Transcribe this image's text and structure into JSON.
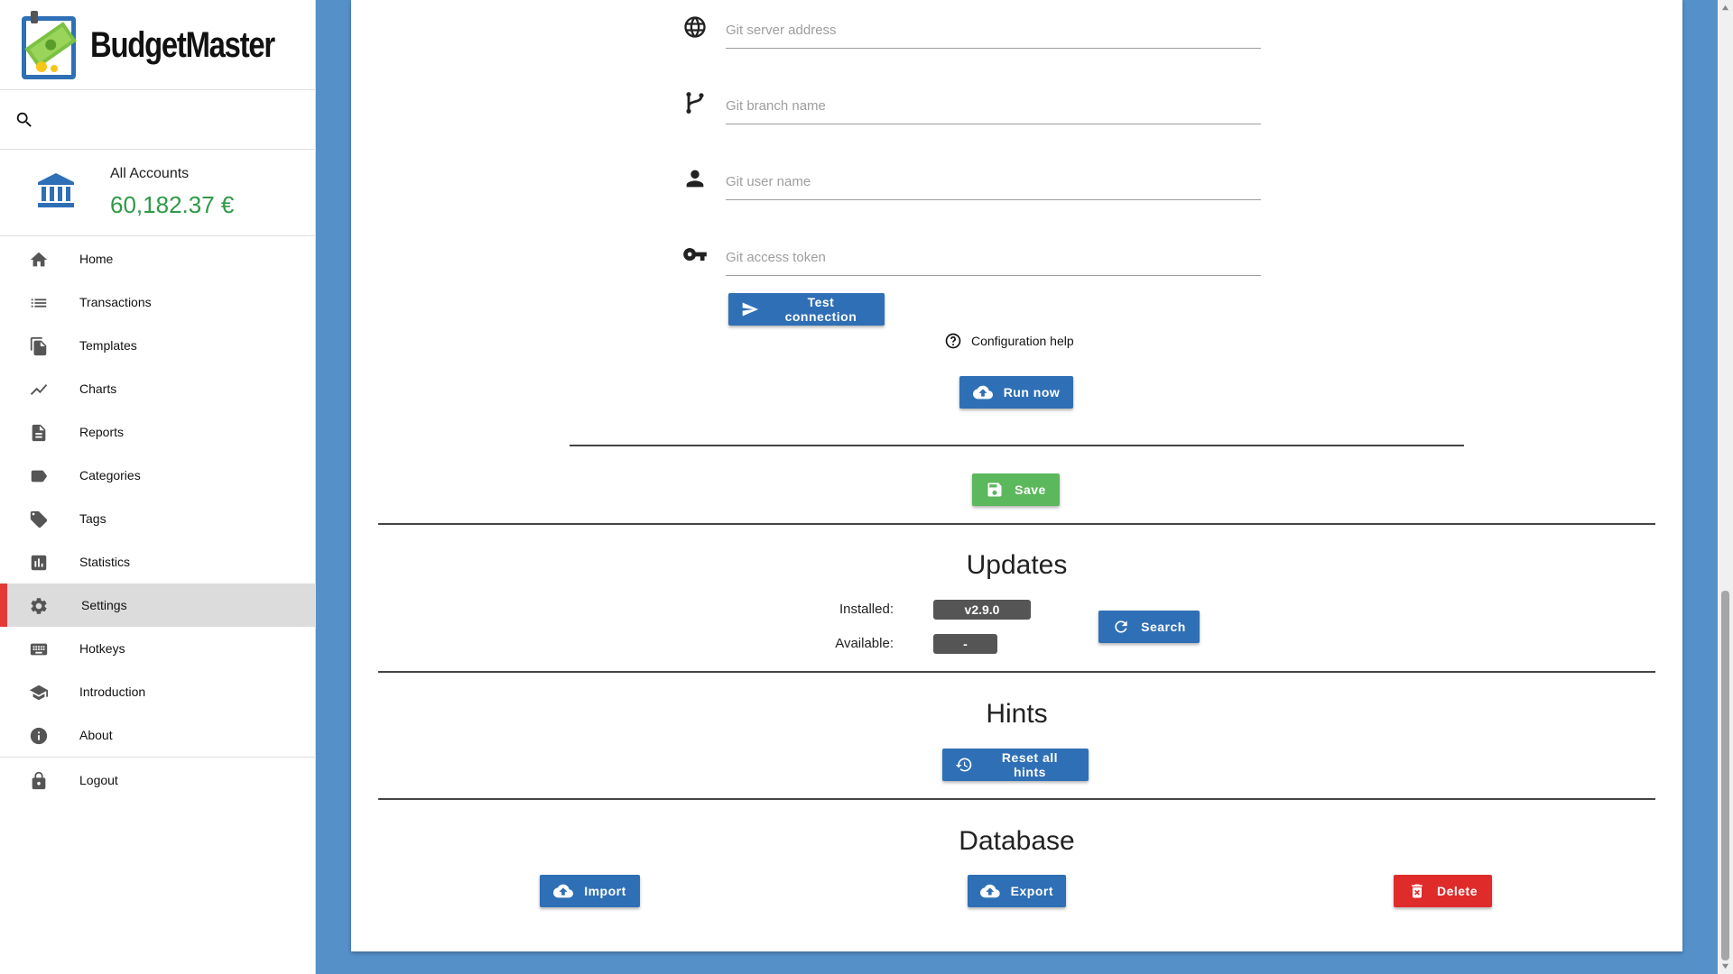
{
  "app": {
    "name": "BudgetMaster",
    "search_placeholder": ""
  },
  "account": {
    "label": "All Accounts",
    "balance": "60,182.37 €",
    "balance_color": "#2e9a47"
  },
  "nav": {
    "items": [
      {
        "label": "Home",
        "icon": "home-icon"
      },
      {
        "label": "Transactions",
        "icon": "list-icon"
      },
      {
        "label": "Templates",
        "icon": "copy-icon"
      },
      {
        "label": "Charts",
        "icon": "line-chart-icon"
      },
      {
        "label": "Reports",
        "icon": "document-icon"
      },
      {
        "label": "Categories",
        "icon": "label-icon"
      },
      {
        "label": "Tags",
        "icon": "tag-icon"
      },
      {
        "label": "Statistics",
        "icon": "bar-chart-icon"
      },
      {
        "label": "Settings",
        "icon": "gear-icon",
        "active": true
      },
      {
        "label": "Hotkeys",
        "icon": "keyboard-icon"
      },
      {
        "label": "Introduction",
        "icon": "graduation-cap-icon"
      },
      {
        "label": "About",
        "icon": "info-icon"
      }
    ],
    "logout": {
      "label": "Logout",
      "icon": "lock-icon"
    },
    "active_marker_color": "#e53935"
  },
  "git": {
    "server_placeholder": "Git server address",
    "branch_placeholder": "Git branch name",
    "user_placeholder": "Git user name",
    "token_placeholder": "Git access token",
    "test_button": "Test connection",
    "help_link": "Configuration help",
    "run_button": "Run now"
  },
  "save_button": "Save",
  "updates": {
    "title": "Updates",
    "installed_label": "Installed:",
    "installed_value": "v2.9.0",
    "available_label": "Available:",
    "available_value": "-",
    "search_button": "Search"
  },
  "hints": {
    "title": "Hints",
    "reset_button": "Reset all hints"
  },
  "database": {
    "title": "Database",
    "import_button": "Import",
    "export_button": "Export",
    "delete_button": "Delete"
  },
  "colors": {
    "primary": "#2f6fb6",
    "success": "#5cb85c",
    "danger": "#e02b2b",
    "background": "#5590c8"
  }
}
